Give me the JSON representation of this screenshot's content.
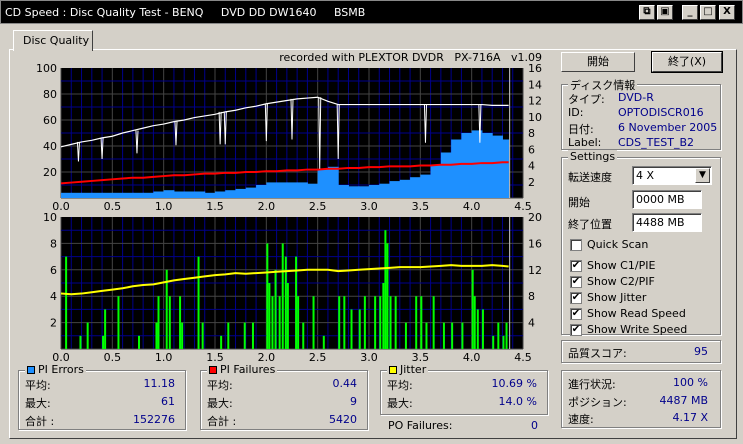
{
  "window": {
    "title": "CD Speed : Disc Quality Test - BENQ     DVD DD DW1640     BSMB",
    "buttons": [
      "copy-icon",
      "save-icon",
      "minimize-icon",
      "maximize-icon",
      "close-icon"
    ]
  },
  "tab": "Disc Quality",
  "recorded_with": "recorded with PLEXTOR DVDR   PX-716A   v1.09",
  "buttons": {
    "start": "開始",
    "exit": "終了(X)"
  },
  "disc_info": {
    "legend": "ディスク情報",
    "type_label": "タイプ:",
    "type": "DVD-R",
    "id_label": "ID:",
    "id": "OPTODISCR016",
    "date_label": "日付:",
    "date": "6 November 2005",
    "label_label": "Label:",
    "label": "CDS_TEST_B2"
  },
  "settings": {
    "legend": "Settings",
    "speed_label": "転送速度",
    "speed": "4 X",
    "start_label": "開始",
    "start": "0000 MB",
    "end_label": "終了位置",
    "end": "4488 MB",
    "checks": [
      {
        "label": "Quick Scan",
        "checked": false
      },
      {
        "label": "Show C1/PIE",
        "checked": true
      },
      {
        "label": "Show C2/PIF",
        "checked": true
      },
      {
        "label": "Show Jitter",
        "checked": true
      },
      {
        "label": "Show Read Speed",
        "checked": true
      },
      {
        "label": "Show Write Speed",
        "checked": true
      }
    ]
  },
  "quality": {
    "label": "品質スコア:",
    "value": "95"
  },
  "progress": {
    "progress_label": "進行状況:",
    "progress": "100 %",
    "position_label": "ポジション:",
    "position": "4487 MB",
    "speed_label": "速度:",
    "speed": "4.17 X"
  },
  "pi_errors": {
    "legend": "PI Errors",
    "color": "#1e90ff",
    "avg_label": "平均:",
    "avg": "11.18",
    "max_label": "最大:",
    "max": "61",
    "total_label": "合計 :",
    "total": "152276"
  },
  "pi_failures": {
    "legend": "PI Failures",
    "color": "#ff0000",
    "avg_label": "平均:",
    "avg": "0.44",
    "max_label": "最大:",
    "max": "9",
    "total_label": "合計 :",
    "total": "5420"
  },
  "jitter": {
    "legend": "Jitter",
    "color": "#ffff00",
    "avg_label": "平均:",
    "avg": "10.69 %",
    "max_label": "最大:",
    "max": "14.0 %"
  },
  "po_failures": {
    "label": "PO Failures:",
    "value": "0"
  },
  "chart_data": [
    {
      "type": "area",
      "xlim": [
        0,
        4.5
      ],
      "ylim": [
        0,
        100
      ],
      "y2lim": [
        0,
        16
      ],
      "grid": true,
      "xticks": [
        "0.0",
        "0.5",
        "1.0",
        "1.5",
        "2.0",
        "2.5",
        "3.0",
        "3.5",
        "4.0",
        "4.5"
      ],
      "yticks": [
        "20",
        "40",
        "60",
        "80",
        "100"
      ],
      "y2ticks": [
        "2",
        "4",
        "6",
        "8",
        "10",
        "12",
        "14",
        "16"
      ],
      "x": [
        0,
        0.1,
        0.2,
        0.3,
        0.4,
        0.5,
        0.6,
        0.7,
        0.8,
        0.9,
        1.0,
        1.1,
        1.2,
        1.3,
        1.4,
        1.5,
        1.6,
        1.7,
        1.8,
        1.9,
        2.0,
        2.1,
        2.2,
        2.3,
        2.4,
        2.5,
        2.6,
        2.7,
        2.8,
        2.9,
        3.0,
        3.1,
        3.2,
        3.3,
        3.4,
        3.5,
        3.6,
        3.7,
        3.8,
        3.9,
        4.0,
        4.1,
        4.2,
        4.3,
        4.36
      ],
      "series": [
        {
          "name": "PI Errors",
          "axis": "left",
          "color": "#1e90ff",
          "values": [
            4,
            4,
            4,
            4,
            4,
            4,
            4,
            4,
            4,
            5,
            6,
            5,
            5,
            5,
            4,
            5,
            6,
            7,
            8,
            10,
            12,
            12,
            12,
            12,
            11,
            22,
            24,
            10,
            9,
            9,
            10,
            11,
            13,
            14,
            16,
            18,
            25,
            35,
            45,
            50,
            52,
            50,
            48,
            45,
            35
          ]
        },
        {
          "axis": "right",
          "color": "#ffffff",
          "values": [
            6.3,
            6.6,
            6.9,
            7.1,
            7.4,
            7.6,
            8.0,
            8.3,
            8.6,
            8.9,
            9.1,
            9.4,
            9.6,
            9.9,
            10.1,
            10.3,
            10.6,
            10.8,
            11.1,
            11.3,
            11.6,
            11.8,
            12.0,
            12.2,
            12.3,
            12.4,
            11.9,
            11.5,
            11.5,
            11.5,
            11.5,
            11.5,
            11.5,
            11.5,
            11.5,
            11.5,
            11.5,
            11.5,
            11.5,
            11.5,
            11.5,
            11.5,
            11.4,
            11.4,
            11.4
          ]
        },
        {
          "axis": "right",
          "color": "#ff0000",
          "values": [
            1.8,
            1.9,
            2.0,
            2.1,
            2.2,
            2.3,
            2.4,
            2.5,
            2.5,
            2.6,
            2.7,
            2.8,
            2.8,
            2.9,
            3.0,
            3.0,
            3.1,
            3.1,
            3.2,
            3.2,
            3.3,
            3.3,
            3.4,
            3.4,
            3.5,
            3.5,
            3.6,
            3.6,
            3.7,
            3.7,
            3.8,
            3.8,
            3.9,
            3.9,
            3.9,
            4.0,
            4.0,
            4.1,
            4.1,
            4.2,
            4.2,
            4.3,
            4.3,
            4.4,
            4.4
          ]
        }
      ],
      "read_dips": [
        [
          0.17,
          4.5
        ],
        [
          0.4,
          4.8
        ],
        [
          0.74,
          5.5
        ],
        [
          1.12,
          6.5
        ],
        [
          1.55,
          6.6
        ],
        [
          1.6,
          6.6
        ],
        [
          2.0,
          7.0
        ],
        [
          2.25,
          7.2
        ],
        [
          2.52,
          3.6
        ],
        [
          2.7,
          4.8
        ],
        [
          3.55,
          6.8
        ],
        [
          4.08,
          6.8
        ]
      ]
    },
    {
      "type": "bar+line",
      "xlim": [
        0,
        4.5
      ],
      "ylim": [
        0,
        10
      ],
      "y2lim": [
        0,
        20
      ],
      "grid": true,
      "xticks": [
        "0.0",
        "0.5",
        "1.0",
        "1.5",
        "2.0",
        "2.5",
        "3.0",
        "3.5",
        "4.0",
        "4.5"
      ],
      "yticks": [
        "2",
        "4",
        "6",
        "8",
        "10"
      ],
      "y2ticks": [
        "4",
        "8",
        "12",
        "16",
        "20"
      ],
      "pi_failures": {
        "color": "#00ff00",
        "x": [
          0.04,
          0.18,
          0.25,
          0.4,
          0.42,
          0.55,
          0.75,
          0.92,
          0.94,
          1.02,
          1.05,
          1.15,
          1.17,
          1.33,
          1.37,
          1.55,
          1.62,
          1.78,
          1.86,
          2.0,
          2.02,
          2.05,
          2.08,
          2.12,
          2.15,
          2.18,
          2.2,
          2.28,
          2.3,
          2.35,
          2.45,
          2.55,
          2.7,
          2.75,
          2.82,
          2.9,
          2.95,
          3.05,
          3.1,
          3.13,
          3.15,
          3.17,
          3.2,
          3.25,
          3.35,
          3.45,
          3.5,
          3.55,
          3.62,
          3.72,
          3.8,
          3.9,
          4.0,
          4.02,
          4.05,
          4.1,
          4.2,
          4.25,
          4.3,
          4.33
        ],
        "values": [
          7,
          1,
          2,
          1,
          3,
          4,
          1,
          2,
          4,
          6,
          4,
          4,
          2,
          7,
          2,
          1,
          2,
          2,
          2,
          8,
          5,
          4,
          6,
          4,
          8,
          7,
          5,
          7,
          4,
          2,
          4,
          1,
          4,
          4,
          3,
          3,
          4,
          4,
          4,
          5,
          9,
          8,
          4,
          4,
          2,
          4,
          4,
          2,
          4,
          2,
          2,
          2,
          6,
          4,
          3,
          3,
          1,
          2,
          1,
          2
        ]
      },
      "jitter": {
        "color": "#ffff00",
        "axis": "right",
        "values": [
          8.4,
          8.3,
          8.4,
          8.6,
          8.8,
          9.0,
          9.2,
          9.5,
          9.7,
          9.8,
          10.1,
          10.4,
          10.6,
          10.8,
          11.0,
          11.2,
          11.3,
          11.5,
          11.4,
          11.5,
          11.6,
          11.7,
          11.8,
          11.9,
          12.0,
          12.0,
          12.0,
          11.8,
          11.9,
          12.0,
          12.1,
          12.2,
          12.3,
          12.4,
          12.4,
          12.4,
          12.5,
          12.6,
          12.7,
          12.6,
          12.6,
          12.6,
          12.7,
          12.6,
          12.5
        ]
      }
    }
  ]
}
